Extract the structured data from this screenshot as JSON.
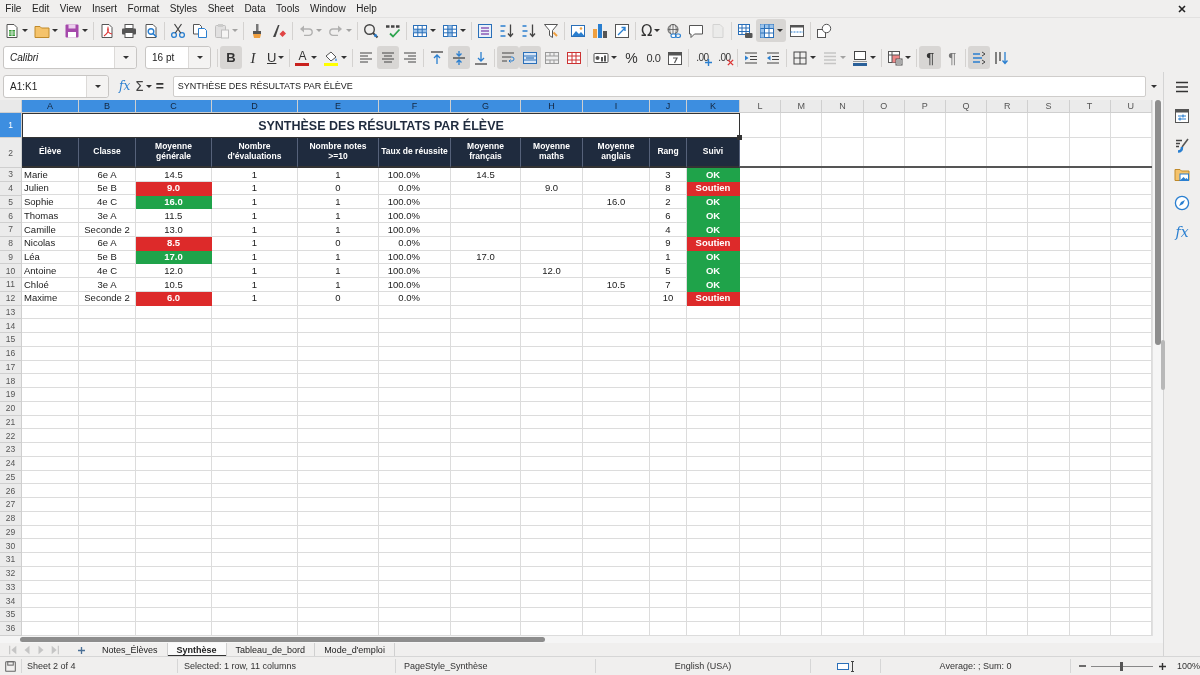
{
  "menu_bar": [
    "File",
    "Edit",
    "View",
    "Insert",
    "Format",
    "Styles",
    "Sheet",
    "Data",
    "Tools",
    "Window",
    "Help"
  ],
  "standard_toolbar": [
    [
      {
        "kind": "new",
        "pressed": false,
        "disabled": false,
        "dropdown": true
      },
      {
        "kind": "open",
        "pressed": false,
        "disabled": false,
        "dropdown": true
      },
      {
        "kind": "save",
        "pressed": false,
        "disabled": false,
        "dropdown": true
      }
    ],
    [
      {
        "kind": "export-pdf",
        "pressed": false,
        "disabled": false,
        "dropdown": false
      },
      {
        "kind": "print",
        "pressed": false,
        "disabled": false,
        "dropdown": false
      },
      {
        "kind": "print-preview",
        "pressed": false,
        "disabled": false,
        "dropdown": false
      }
    ],
    [
      {
        "kind": "cut",
        "pressed": false,
        "disabled": false,
        "dropdown": false
      },
      {
        "kind": "copy",
        "pressed": false,
        "disabled": false,
        "dropdown": false
      },
      {
        "kind": "paste",
        "pressed": false,
        "disabled": true,
        "dropdown": true
      }
    ],
    [
      {
        "kind": "clone-formatting",
        "pressed": false,
        "disabled": false,
        "dropdown": false
      },
      {
        "kind": "clear-formatting",
        "pressed": false,
        "disabled": false,
        "dropdown": false
      }
    ],
    [
      {
        "kind": "undo",
        "pressed": false,
        "disabled": true,
        "dropdown": true
      },
      {
        "kind": "redo",
        "pressed": false,
        "disabled": true,
        "dropdown": true
      }
    ],
    [
      {
        "kind": "find-replace",
        "pressed": false,
        "disabled": false,
        "dropdown": false
      },
      {
        "kind": "spelling",
        "pressed": false,
        "disabled": false,
        "dropdown": false
      }
    ],
    [
      {
        "kind": "insert-rows",
        "pressed": false,
        "disabled": false,
        "dropdown": true
      },
      {
        "kind": "insert-columns",
        "pressed": false,
        "disabled": false,
        "dropdown": true
      }
    ],
    [
      {
        "kind": "sort",
        "pressed": false,
        "disabled": false,
        "dropdown": false
      },
      {
        "kind": "sort-ascending",
        "pressed": false,
        "disabled": false,
        "dropdown": false
      },
      {
        "kind": "sort-descending",
        "pressed": false,
        "disabled": false,
        "dropdown": false
      },
      {
        "kind": "autofilter",
        "pressed": false,
        "disabled": false,
        "dropdown": false
      }
    ],
    [
      {
        "kind": "image",
        "pressed": false,
        "disabled": false,
        "dropdown": false
      },
      {
        "kind": "chart",
        "pressed": false,
        "disabled": false,
        "dropdown": false
      },
      {
        "kind": "pivot-table",
        "pressed": false,
        "disabled": false,
        "dropdown": false
      }
    ],
    [
      {
        "kind": "special-character",
        "glyph": "Ω",
        "pressed": false,
        "disabled": false,
        "dropdown": true
      },
      {
        "kind": "hyperlink",
        "pressed": false,
        "disabled": false,
        "dropdown": false
      },
      {
        "kind": "comment",
        "pressed": false,
        "disabled": false,
        "dropdown": false
      },
      {
        "kind": "headers-footers",
        "pressed": false,
        "disabled": true,
        "dropdown": false
      }
    ],
    [
      {
        "kind": "print-area",
        "pressed": false,
        "disabled": false,
        "dropdown": false
      },
      {
        "kind": "freeze",
        "pressed": true,
        "disabled": false,
        "dropdown": true
      },
      {
        "kind": "split-window",
        "pressed": false,
        "disabled": false,
        "dropdown": false
      }
    ],
    [
      {
        "kind": "draw-functions",
        "pressed": false,
        "disabled": false,
        "dropdown": false
      }
    ]
  ],
  "formatting_toolbar": {
    "font_name": "Calibri",
    "font_size": "16 pt",
    "groups": [
      [
        {
          "kind": "bold",
          "glyph": "B",
          "pressed": true,
          "disabled": false,
          "dropdown": false
        },
        {
          "kind": "italic",
          "glyph": "I",
          "pressed": false,
          "disabled": false,
          "dropdown": false
        },
        {
          "kind": "underline",
          "glyph": "U",
          "pressed": false,
          "disabled": false,
          "dropdown": true
        }
      ],
      [
        {
          "kind": "font-color",
          "glyph": "A",
          "color": "#c9211e",
          "pressed": false,
          "disabled": false,
          "dropdown": true
        },
        {
          "kind": "highlight",
          "color": "#ffff00",
          "pressed": false,
          "disabled": false,
          "dropdown": true
        }
      ],
      [
        {
          "kind": "align-left",
          "pressed": false,
          "disabled": false,
          "dropdown": false
        },
        {
          "kind": "align-center",
          "pressed": true,
          "disabled": false,
          "dropdown": false
        },
        {
          "kind": "align-right",
          "pressed": false,
          "disabled": false,
          "dropdown": false
        }
      ],
      [
        {
          "kind": "align-top",
          "pressed": false,
          "disabled": false,
          "dropdown": false
        },
        {
          "kind": "align-middle",
          "pressed": true,
          "disabled": false,
          "dropdown": false
        },
        {
          "kind": "align-bottom",
          "pressed": false,
          "disabled": false,
          "dropdown": false
        }
      ],
      [
        {
          "kind": "wrap-text",
          "pressed": true,
          "disabled": false,
          "dropdown": false
        },
        {
          "kind": "merge-center",
          "pressed": true,
          "disabled": false,
          "dropdown": false
        },
        {
          "kind": "merge",
          "pressed": false,
          "disabled": false,
          "dropdown": false
        },
        {
          "kind": "unmerge",
          "pressed": false,
          "disabled": false,
          "dropdown": false
        }
      ],
      [
        {
          "kind": "currency",
          "pressed": false,
          "disabled": false,
          "dropdown": true
        },
        {
          "kind": "percent",
          "glyph": "%",
          "pressed": false,
          "disabled": false,
          "dropdown": false
        },
        {
          "kind": "number",
          "glyph": "0.0",
          "pressed": false,
          "disabled": false,
          "dropdown": false
        },
        {
          "kind": "date",
          "pressed": false,
          "disabled": false,
          "dropdown": false
        }
      ],
      [
        {
          "kind": "add-decimal",
          "glyph": ".00",
          "pressed": false,
          "disabled": false,
          "dropdown": false
        },
        {
          "kind": "delete-decimal",
          "glyph": ".00",
          "pressed": false,
          "disabled": false,
          "dropdown": false
        }
      ],
      [
        {
          "kind": "indent",
          "pressed": false,
          "disabled": false,
          "dropdown": false
        },
        {
          "kind": "outdent",
          "pressed": false,
          "disabled": false,
          "dropdown": false
        }
      ],
      [
        {
          "kind": "borders",
          "pressed": false,
          "disabled": false,
          "dropdown": true
        },
        {
          "kind": "border-style",
          "pressed": false,
          "disabled": true,
          "dropdown": true
        },
        {
          "kind": "border-color",
          "color": "#2a6099",
          "pressed": false,
          "disabled": false,
          "dropdown": true
        }
      ],
      [
        {
          "kind": "conditional",
          "pressed": false,
          "disabled": false,
          "dropdown": true
        }
      ],
      [
        {
          "kind": "left-to-right",
          "glyph": "¶",
          "pressed": true,
          "disabled": false,
          "dropdown": false
        },
        {
          "kind": "right-to-left",
          "glyph": "¶",
          "pressed": false,
          "disabled": false,
          "dropdown": false
        }
      ],
      [
        {
          "kind": "text-horizontal",
          "pressed": true,
          "disabled": false,
          "dropdown": false
        },
        {
          "kind": "text-vertical",
          "pressed": false,
          "disabled": false,
          "dropdown": false
        }
      ]
    ]
  },
  "formula_bar": {
    "name_box": "A1:K1",
    "buttons": [
      {
        "kind": "function-wizard",
        "glyph": "fx",
        "dropdown": false
      },
      {
        "kind": "sum",
        "glyph": "Σ",
        "dropdown": true
      },
      {
        "kind": "formula",
        "glyph": "=",
        "dropdown": false
      }
    ],
    "content": "SYNTHÈSE DES RÉSULTATS PAR ÉLÈVE"
  },
  "sheet": {
    "column_headers": [
      {
        "label": "A",
        "selected": true
      },
      {
        "label": "B",
        "selected": true
      },
      {
        "label": "C",
        "selected": true
      },
      {
        "label": "D",
        "selected": true
      },
      {
        "label": "E",
        "selected": true
      },
      {
        "label": "F",
        "selected": true
      },
      {
        "label": "G",
        "selected": true
      },
      {
        "label": "H",
        "selected": true
      },
      {
        "label": "I",
        "selected": true
      },
      {
        "label": "J",
        "selected": true
      },
      {
        "label": "K",
        "selected": true
      },
      {
        "label": "L",
        "selected": false
      },
      {
        "label": "M",
        "selected": false
      },
      {
        "label": "N",
        "selected": false
      },
      {
        "label": "O",
        "selected": false
      },
      {
        "label": "P",
        "selected": false
      },
      {
        "label": "Q",
        "selected": false
      },
      {
        "label": "R",
        "selected": false
      },
      {
        "label": "S",
        "selected": false
      },
      {
        "label": "T",
        "selected": false
      },
      {
        "label": "U",
        "selected": false
      }
    ],
    "row_headers": [
      {
        "label": "1",
        "selected": true
      },
      {
        "label": "2",
        "selected": false
      },
      {
        "label": "3",
        "selected": false
      },
      {
        "label": "4",
        "selected": false
      },
      {
        "label": "5",
        "selected": false
      },
      {
        "label": "6",
        "selected": false
      },
      {
        "label": "7",
        "selected": false
      },
      {
        "label": "8",
        "selected": false
      },
      {
        "label": "9",
        "selected": false
      },
      {
        "label": "10",
        "selected": false
      },
      {
        "label": "11",
        "selected": false
      },
      {
        "label": "12",
        "selected": false
      },
      {
        "label": "13",
        "selected": false
      },
      {
        "label": "14",
        "selected": false
      },
      {
        "label": "15",
        "selected": false
      },
      {
        "label": "16",
        "selected": false
      },
      {
        "label": "17",
        "selected": false
      },
      {
        "label": "18",
        "selected": false
      },
      {
        "label": "19",
        "selected": false
      },
      {
        "label": "20",
        "selected": false
      },
      {
        "label": "21",
        "selected": false
      },
      {
        "label": "22",
        "selected": false
      },
      {
        "label": "23",
        "selected": false
      },
      {
        "label": "24",
        "selected": false
      },
      {
        "label": "25",
        "selected": false
      },
      {
        "label": "26",
        "selected": false
      },
      {
        "label": "27",
        "selected": false
      },
      {
        "label": "28",
        "selected": false
      },
      {
        "label": "29",
        "selected": false
      },
      {
        "label": "30",
        "selected": false
      },
      {
        "label": "31",
        "selected": false
      },
      {
        "label": "32",
        "selected": false
      },
      {
        "label": "33",
        "selected": false
      },
      {
        "label": "34",
        "selected": false
      },
      {
        "label": "35",
        "selected": false
      },
      {
        "label": "36",
        "selected": false
      }
    ],
    "title": "SYNTHÈSE DES RÉSULTATS PAR ÉLÈVE",
    "headings": [
      "Élève",
      "Classe",
      "Moyenne générale",
      "Nombre d'évaluations",
      "Nombre notes >=10",
      "Taux de réussite",
      "Moyenne français",
      "Moyenne maths",
      "Moyenne anglais",
      "Rang",
      "Suivi"
    ],
    "rows": [
      {
        "eleve": "Marie",
        "classe": "6e A",
        "moyenne_generale": {
          "text": "14.5"
        },
        "nombre_evaluations": "1",
        "nombre_notes_10": "1",
        "taux_reussite": "100.0%",
        "moyenne_francais": "14.5",
        "rang": "3",
        "suivi": {
          "text": "OK",
          "color": "#1fa34a"
        }
      },
      {
        "eleve": "Julien",
        "classe": "5e B",
        "moyenne_generale": {
          "text": "9.0",
          "color": "#dd2a2a"
        },
        "nombre_evaluations": "1",
        "nombre_notes_10": "0",
        "taux_reussite": "0.0%",
        "moyenne_maths": "9.0",
        "rang": "8",
        "suivi": {
          "text": "Soutien",
          "color": "#dd2a2a"
        }
      },
      {
        "eleve": "Sophie",
        "classe": "4e C",
        "moyenne_generale": {
          "text": "16.0",
          "color": "#1fa34a"
        },
        "nombre_evaluations": "1",
        "nombre_notes_10": "1",
        "taux_reussite": "100.0%",
        "moyenne_anglais": "16.0",
        "rang": "2",
        "suivi": {
          "text": "OK",
          "color": "#1fa34a"
        }
      },
      {
        "eleve": "Thomas",
        "classe": "3e A",
        "moyenne_generale": {
          "text": "11.5"
        },
        "nombre_evaluations": "1",
        "nombre_notes_10": "1",
        "taux_reussite": "100.0%",
        "rang": "6",
        "suivi": {
          "text": "OK",
          "color": "#1fa34a"
        }
      },
      {
        "eleve": "Camille",
        "classe": "Seconde 2",
        "moyenne_generale": {
          "text": "13.0"
        },
        "nombre_evaluations": "1",
        "nombre_notes_10": "1",
        "taux_reussite": "100.0%",
        "rang": "4",
        "suivi": {
          "text": "OK",
          "color": "#1fa34a"
        }
      },
      {
        "eleve": "Nicolas",
        "classe": "6e A",
        "moyenne_generale": {
          "text": "8.5",
          "color": "#dd2a2a"
        },
        "nombre_evaluations": "1",
        "nombre_notes_10": "0",
        "taux_reussite": "0.0%",
        "rang": "9",
        "suivi": {
          "text": "Soutien",
          "color": "#dd2a2a"
        }
      },
      {
        "eleve": "Léa",
        "classe": "5e B",
        "moyenne_generale": {
          "text": "17.0",
          "color": "#1fa34a"
        },
        "nombre_evaluations": "1",
        "nombre_notes_10": "1",
        "taux_reussite": "100.0%",
        "moyenne_francais": "17.0",
        "rang": "1",
        "suivi": {
          "text": "OK",
          "color": "#1fa34a"
        }
      },
      {
        "eleve": "Antoine",
        "classe": "4e C",
        "moyenne_generale": {
          "text": "12.0"
        },
        "nombre_evaluations": "1",
        "nombre_notes_10": "1",
        "taux_reussite": "100.0%",
        "moyenne_maths": "12.0",
        "rang": "5",
        "suivi": {
          "text": "OK",
          "color": "#1fa34a"
        }
      },
      {
        "eleve": "Chloé",
        "classe": "3e A",
        "moyenne_generale": {
          "text": "10.5"
        },
        "nombre_evaluations": "1",
        "nombre_notes_10": "1",
        "taux_reussite": "100.0%",
        "moyenne_anglais": "10.5",
        "rang": "7",
        "suivi": {
          "text": "OK",
          "color": "#1fa34a"
        }
      },
      {
        "eleve": "Maxime",
        "classe": "Seconde 2",
        "moyenne_generale": {
          "text": "6.0",
          "color": "#dd2a2a"
        },
        "nombre_evaluations": "1",
        "nombre_notes_10": "0",
        "taux_reussite": "0.0%",
        "rang": "10",
        "suivi": {
          "text": "Soutien",
          "color": "#dd2a2a"
        }
      }
    ]
  },
  "sheet_tabs": {
    "navigation": [
      {
        "kind": "first",
        "disabled": true
      },
      {
        "kind": "previous",
        "disabled": true
      },
      {
        "kind": "next",
        "disabled": true
      },
      {
        "kind": "last",
        "disabled": true
      }
    ],
    "tabs": [
      {
        "label": "Notes_Élèves",
        "selected": false
      },
      {
        "label": "Synthèse",
        "selected": true
      },
      {
        "label": "Tableau_de_bord",
        "selected": false
      },
      {
        "label": "Mode_d'emploi",
        "selected": false
      }
    ]
  },
  "sidebar": [
    {
      "kind": "menu",
      "selected": false
    },
    {
      "kind": "properties",
      "selected": false
    },
    {
      "kind": "styles",
      "selected": false
    },
    {
      "kind": "gallery",
      "selected": false
    },
    {
      "kind": "navigator",
      "selected": false
    },
    {
      "kind": "functions",
      "glyph": "fx",
      "selected": false
    }
  ],
  "status_bar": {
    "sheet": "Sheet 2 of 4",
    "selection": "Selected: 1 row, 11 columns",
    "page_style": "PageStyle_Synthèse",
    "language": "English (USA)",
    "summary": "Average: ; Sum: 0",
    "zoom": {
      "level": 0.5,
      "reading": "100%"
    }
  }
}
